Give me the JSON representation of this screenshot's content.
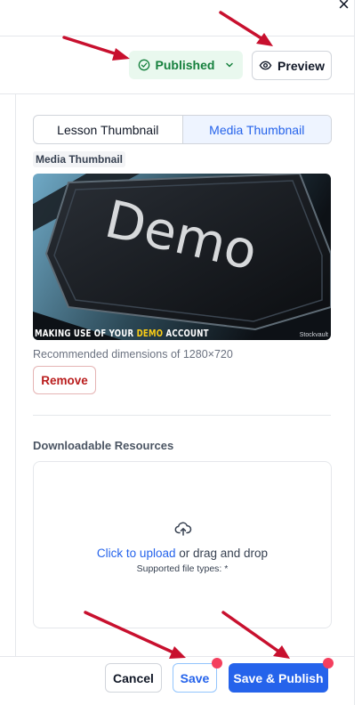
{
  "window": {
    "close_glyph": "×"
  },
  "header": {
    "status": {
      "label": "Published",
      "icon": "check-circle-icon",
      "color": "#15803d",
      "bg": "#e9f8ee"
    },
    "preview": {
      "label": "Preview",
      "icon": "eye-icon"
    }
  },
  "thumbnail": {
    "tabs": [
      {
        "label": "Lesson Thumbnail",
        "active": false
      },
      {
        "label": "Media Thumbnail",
        "active": true
      }
    ],
    "section_label": "Media Thumbnail",
    "image": {
      "word": "Demo",
      "caption_pre": "MAKING USE OF YOUR ",
      "caption_hl": "DEMO",
      "caption_post": " ACCOUNT",
      "watermark": "Stockvault"
    },
    "recommended": "Recommended dimensions of 1280×720",
    "remove_label": "Remove"
  },
  "resources": {
    "title": "Downloadable Resources",
    "upload_link": "Click to upload",
    "upload_rest": " or drag and drop",
    "supported": "Supported file types: *"
  },
  "footer": {
    "cancel_label": "Cancel",
    "save_label": "Save",
    "publish_label": "Save & Publish"
  },
  "colors": {
    "accent": "#2563eb",
    "danger": "#b91c1c",
    "annotation_arrow": "#c8102e",
    "notify_dot": "#f43f5e"
  }
}
